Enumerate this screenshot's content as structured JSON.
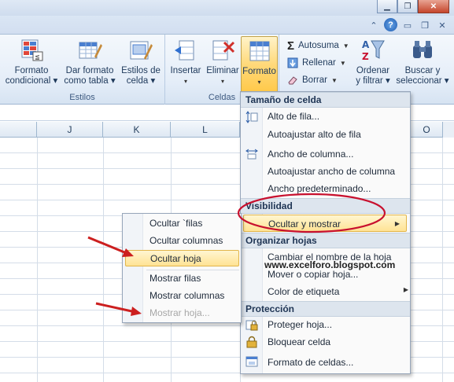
{
  "ribbon": {
    "groups": {
      "estilos": "Estilos",
      "celdas": "Celdas"
    },
    "buttons": {
      "formato_condicional": [
        "Formato",
        "condicional ▾"
      ],
      "dar_formato_tabla": [
        "Dar formato",
        "como tabla ▾"
      ],
      "estilos_celda": [
        "Estilos de",
        "celda ▾"
      ],
      "insertar": [
        "Insertar",
        "▾"
      ],
      "eliminar": [
        "Eliminar",
        "▾"
      ],
      "formato": [
        "Formato",
        "▾"
      ],
      "autosuma": "Autosuma",
      "rellenar": "Rellenar",
      "borrar": "Borrar",
      "ordenar_filtrar": [
        "Ordenar",
        "y filtrar ▾"
      ],
      "buscar_seleccionar": [
        "Buscar y",
        "seleccionar ▾"
      ]
    }
  },
  "columns": [
    "J",
    "K",
    "L",
    "O"
  ],
  "menu": {
    "sections": {
      "tamano": "Tamaño de celda",
      "visibilidad": "Visibilidad",
      "organizar": "Organizar hojas",
      "proteccion": "Protección"
    },
    "items": {
      "alto_fila": "Alto de fila...",
      "autoajustar_alto": "Autoajustar alto de fila",
      "ancho_columna": "Ancho de columna...",
      "autoajustar_ancho": "Autoajustar ancho de columna",
      "ancho_predeterminado": "Ancho predeterminado...",
      "ocultar_mostrar": "Ocultar y mostrar",
      "cambiar_nombre": "Cambiar el nombre de la hoja",
      "mover_copiar": "Mover o copiar hoja...",
      "color_etiqueta": "Color de etiqueta",
      "proteger_hoja": "Proteger hoja...",
      "bloquear_celda": "Bloquear celda",
      "formato_celdas": "Formato de celdas..."
    }
  },
  "submenu": {
    "items": {
      "ocultar_filas": "Ocultar `filas",
      "ocultar_columnas": "Ocultar columnas",
      "ocultar_hoja": "Ocultar hoja",
      "mostrar_filas": "Mostrar filas",
      "mostrar_columnas": "Mostrar columnas",
      "mostrar_hoja": "Mostrar hoja..."
    }
  },
  "watermark": "www.excelforo.blogspot.com",
  "colors": {
    "highlight": "#ffe394",
    "annotation_red": "#c8102e",
    "arrow_red": "#cc1f1f"
  }
}
